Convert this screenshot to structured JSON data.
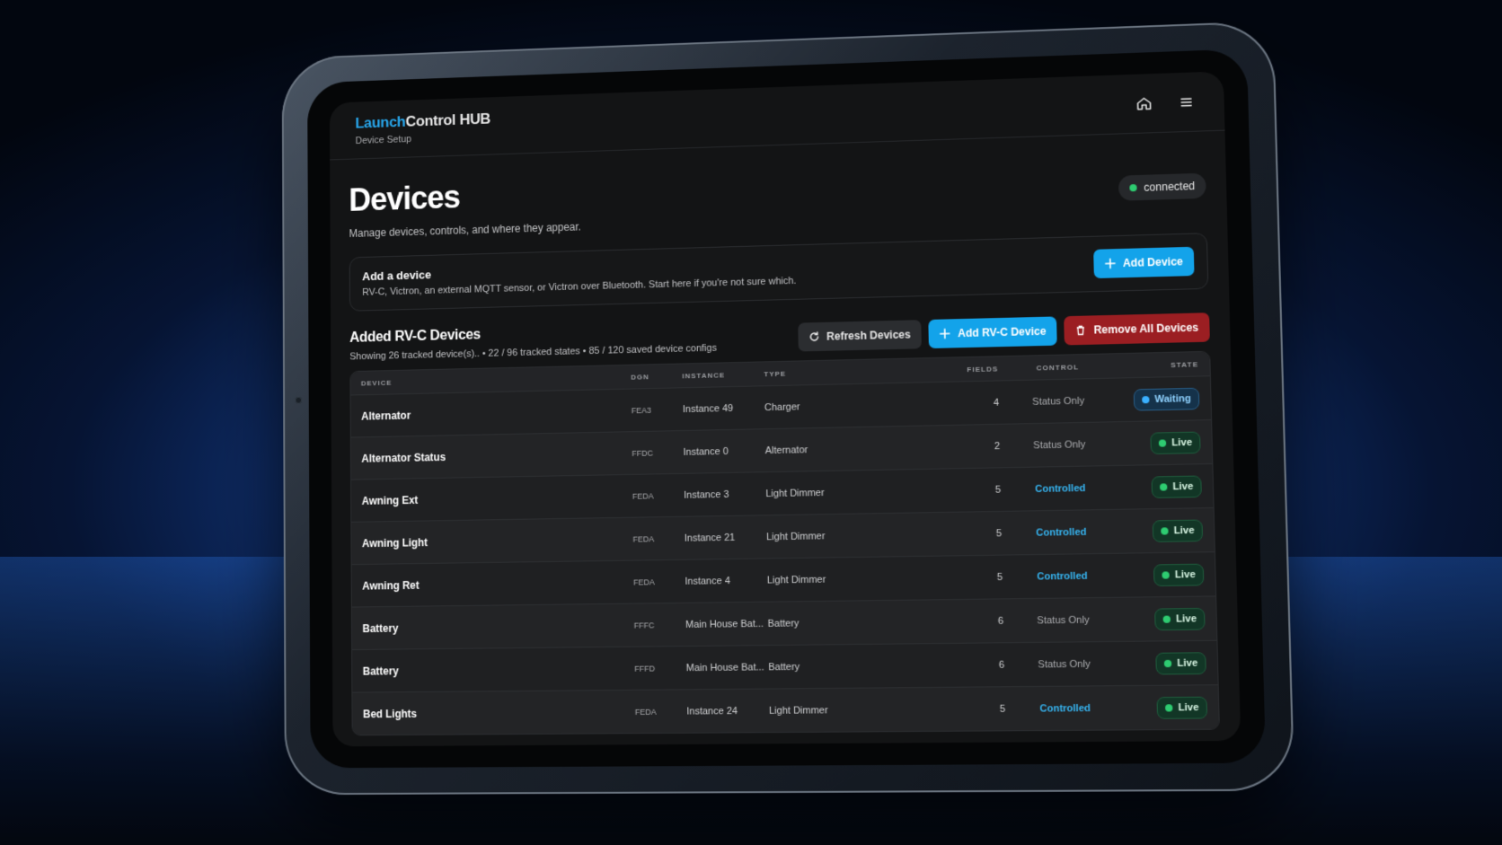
{
  "app": {
    "brand_accent": "Launch",
    "brand_rest": "Control HUB",
    "subtitle": "Device Setup"
  },
  "icons": {
    "home": "home-icon",
    "menu": "hamburger-menu-icon"
  },
  "page": {
    "title": "Devices",
    "description": "Manage devices, controls, and where they appear.",
    "connection_status": "connected"
  },
  "add_card": {
    "title": "Add a device",
    "description": "RV-C, Victron, an external MQTT sensor, or Victron over Bluetooth. Start here if you're not sure which.",
    "button_label": "Add Device"
  },
  "devices_section": {
    "title": "Added RV-C Devices",
    "summary": "Showing 26 tracked device(s).. • 22 / 96 tracked states • 85 / 120 saved device configs",
    "refresh_label": "Refresh Devices",
    "add_rvc_label": "Add RV-C Device",
    "remove_all_label": "Remove All Devices"
  },
  "table": {
    "headers": {
      "device": "DEVICE",
      "dgn": "DGN",
      "instance": "INSTANCE",
      "type": "TYPE",
      "fields": "FIELDS",
      "control": "CONTROL",
      "state": "STATE"
    },
    "rows": [
      {
        "device": "Alternator",
        "dgn": "FEA3",
        "instance": "Instance 49",
        "type": "Charger",
        "fields": "4",
        "control": "Status Only",
        "state": "Waiting"
      },
      {
        "device": "Alternator Status",
        "dgn": "FFDC",
        "instance": "Instance 0",
        "type": "Alternator",
        "fields": "2",
        "control": "Status Only",
        "state": "Live"
      },
      {
        "device": "Awning Ext",
        "dgn": "FEDA",
        "instance": "Instance 3",
        "type": "Light Dimmer",
        "fields": "5",
        "control": "Controlled",
        "state": "Live"
      },
      {
        "device": "Awning Light",
        "dgn": "FEDA",
        "instance": "Instance 21",
        "type": "Light Dimmer",
        "fields": "5",
        "control": "Controlled",
        "state": "Live"
      },
      {
        "device": "Awning Ret",
        "dgn": "FEDA",
        "instance": "Instance 4",
        "type": "Light Dimmer",
        "fields": "5",
        "control": "Controlled",
        "state": "Live"
      },
      {
        "device": "Battery",
        "dgn": "FFFC",
        "instance": "Main House Bat...",
        "type": "Battery",
        "fields": "6",
        "control": "Status Only",
        "state": "Live"
      },
      {
        "device": "Battery",
        "dgn": "FFFD",
        "instance": "Main House Bat...",
        "type": "Battery",
        "fields": "6",
        "control": "Status Only",
        "state": "Live"
      },
      {
        "device": "Bed Lights",
        "dgn": "FEDA",
        "instance": "Instance 24",
        "type": "Light Dimmer",
        "fields": "5",
        "control": "Controlled",
        "state": "Live"
      }
    ]
  },
  "colors": {
    "accent": "#13a3ea",
    "danger": "#9b1e22",
    "live_green": "#2ecc71",
    "controlled_blue": "#36b4f0"
  }
}
